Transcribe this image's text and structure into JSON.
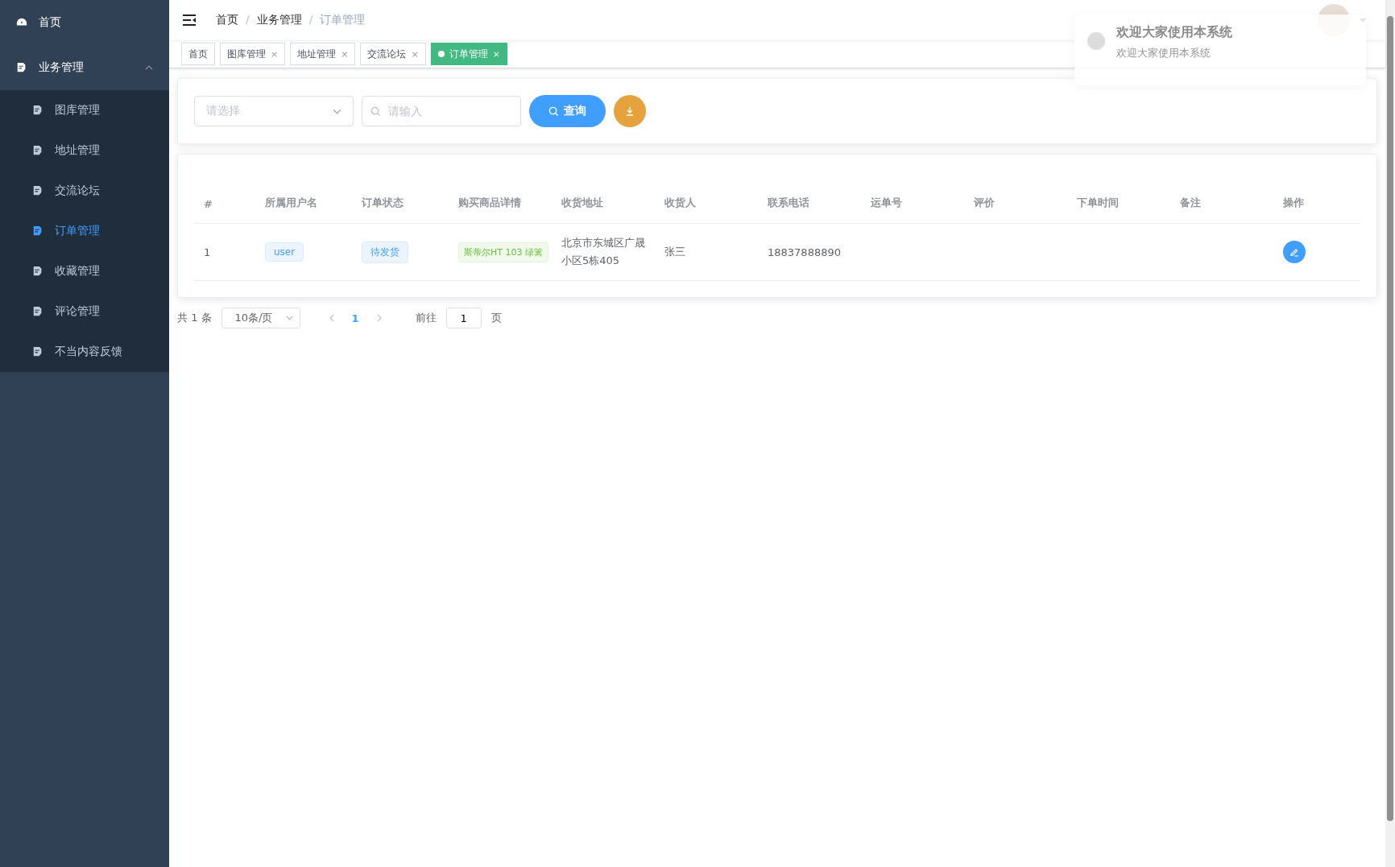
{
  "sidebar": {
    "items": [
      {
        "label": "首页",
        "selected": false
      },
      {
        "label": "业务管理",
        "selected": false,
        "expanded": true,
        "children": [
          {
            "label": "图库管理",
            "selected": false
          },
          {
            "label": "地址管理",
            "selected": false
          },
          {
            "label": "交流论坛",
            "selected": false
          },
          {
            "label": "订单管理",
            "selected": true
          },
          {
            "label": "收藏管理",
            "selected": false
          },
          {
            "label": "评论管理",
            "selected": false
          },
          {
            "label": "不当内容反馈",
            "selected": false
          }
        ]
      }
    ]
  },
  "breadcrumb": [
    "首页",
    "业务管理",
    "订单管理"
  ],
  "breadcrumb_separator": "/",
  "tabs": [
    {
      "label": "首页",
      "selected": false,
      "closable": false
    },
    {
      "label": "图库管理",
      "selected": false,
      "closable": true
    },
    {
      "label": "地址管理",
      "selected": false,
      "closable": true
    },
    {
      "label": "交流论坛",
      "selected": false,
      "closable": true
    },
    {
      "label": "订单管理",
      "selected": true,
      "closable": true
    }
  ],
  "tab_close": "×",
  "notification": {
    "title": "欢迎大家使用本系统",
    "message": "欢迎大家使用本系统"
  },
  "search": {
    "select_placeholder": "请选择",
    "input_placeholder": "请输入",
    "query_button": "查询"
  },
  "table": {
    "columns": [
      "#",
      "所属用户名",
      "订单状态",
      "购买商品详情",
      "收货地址",
      "收货人",
      "联系电话",
      "运单号",
      "评价",
      "下单时间",
      "备注",
      "操作"
    ],
    "rows": [
      {
        "index": "1",
        "user": "user",
        "status": "待发货",
        "product": "斯蒂尔HT 103 绿篱",
        "address": "北京市东城区广晟小区5栋405",
        "receiver": "张三",
        "phone": "18837888890"
      }
    ]
  },
  "pagination": {
    "total": "共 1 条",
    "page_size": "10条/页",
    "pages": [
      {
        "label": "1",
        "selected": true
      }
    ],
    "goto_label": "前往",
    "goto_value": "1",
    "page_unit": "页"
  }
}
